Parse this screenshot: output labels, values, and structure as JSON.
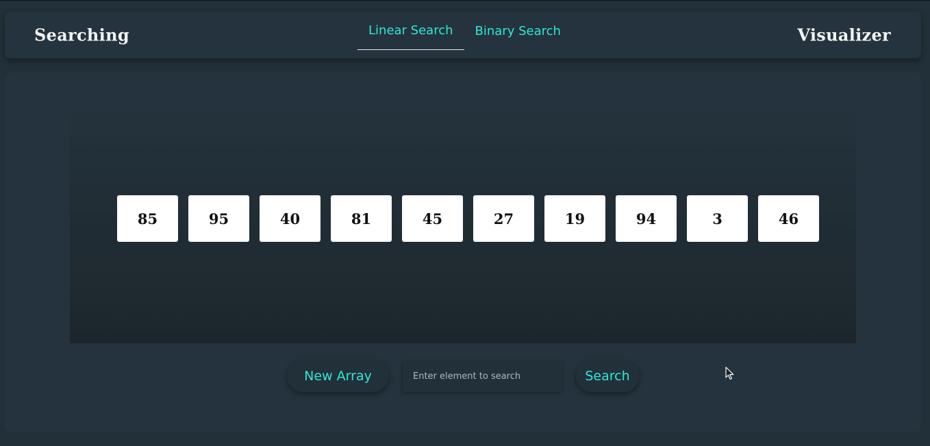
{
  "header": {
    "brand_left": "Searching",
    "brand_right": "Visualizer",
    "tabs": [
      {
        "label": "Linear Search",
        "active": true
      },
      {
        "label": "Binary Search",
        "active": false
      }
    ]
  },
  "array": [
    "85",
    "95",
    "40",
    "81",
    "45",
    "27",
    "19",
    "94",
    "3",
    "46"
  ],
  "controls": {
    "new_array_label": "New Array",
    "search_placeholder": "Enter element to search",
    "search_value": "",
    "search_label": "Search"
  },
  "colors": {
    "accent": "#2ee8d6",
    "background": "#223039",
    "panel": "#24333d",
    "cell": "#ffffff"
  }
}
